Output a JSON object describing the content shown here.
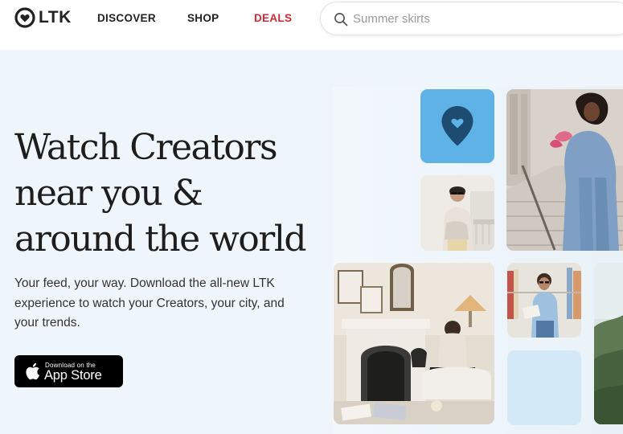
{
  "brand": {
    "name": "LTK"
  },
  "nav": [
    {
      "label": "DISCOVER"
    },
    {
      "label": "SHOP"
    },
    {
      "label": "DEALS"
    }
  ],
  "search": {
    "placeholder": "Summer skirts",
    "value": ""
  },
  "hero": {
    "headline_lines": [
      "Watch Creators",
      "near you &",
      "around the world"
    ],
    "subtext_lines": [
      "Your feed, your way. Download the all-new LTK",
      "experience to watch your Creators, your city, and",
      "your trends."
    ],
    "appstore": {
      "small": "Download on the",
      "big": "App Store"
    }
  },
  "colors": {
    "accent": "#d6262f",
    "pin_tile": "#5fb2e6",
    "blank_tile": "#d4e9f7",
    "background": "#eef6fb"
  }
}
